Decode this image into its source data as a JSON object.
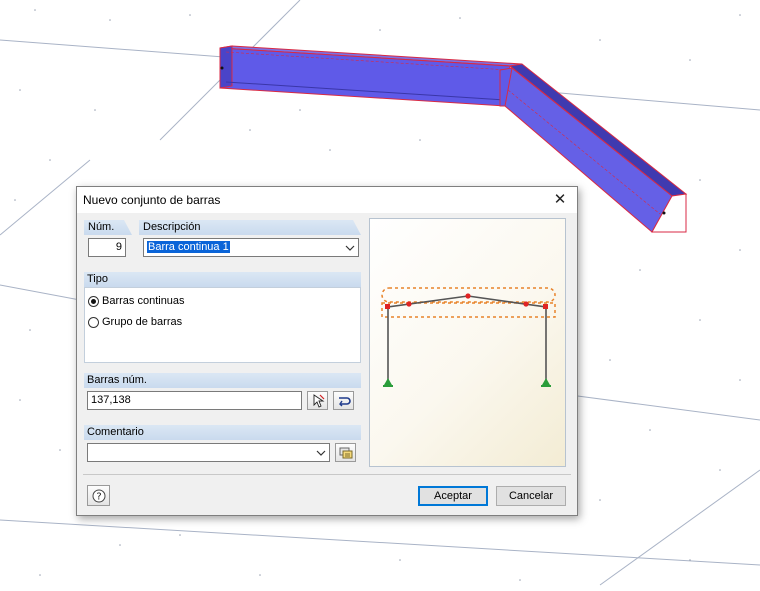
{
  "dialog": {
    "title": "Nuevo conjunto de barras",
    "close_glyph": "✕",
    "num_label": "Núm.",
    "num_value": "9",
    "desc_label": "Descripción",
    "desc_value": "Barra continua 1",
    "tipo_label": "Tipo",
    "tipo_options": [
      "Barras continuas",
      "Grupo de barras"
    ],
    "tipo_selected": "Barras continuas",
    "barras_label": "Barras núm.",
    "barras_value": "137,138",
    "comentario_label": "Comentario",
    "comentario_value": "",
    "accept_label": "Aceptar",
    "cancel_label": "Cancelar"
  },
  "icons": {
    "help": "help-icon",
    "pick": "pick-members-icon",
    "clear": "clear-selection-icon",
    "comment": "comment-library-icon"
  },
  "colors": {
    "member_blue": "#5c5ce8",
    "member_edge": "#e0203a",
    "support_green": "#2a9d3a",
    "highlight_orange": "#e8832a"
  }
}
